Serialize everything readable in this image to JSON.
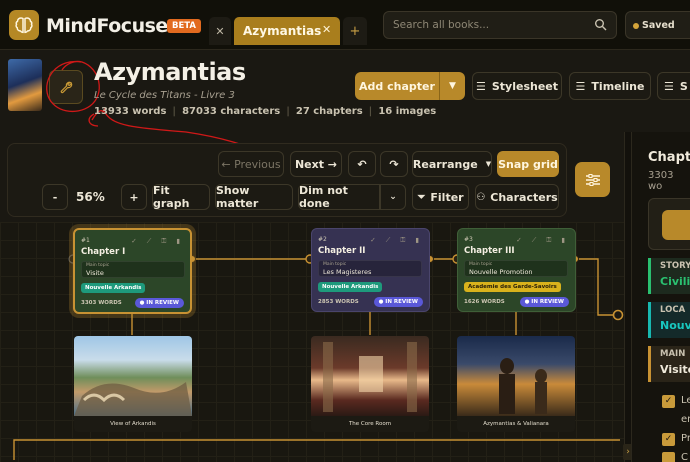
{
  "app": {
    "name": "MindFocuser",
    "badge": "BETA"
  },
  "tabs": [
    {
      "label": "Azymantias",
      "active": true
    }
  ],
  "search": {
    "placeholder": "Search all books..."
  },
  "status": {
    "saved": "Saved"
  },
  "book": {
    "title": "Azymantias",
    "subtitle": "Le Cycle des Titans - Livre 3",
    "words": "13933 words",
    "characters": "87033 characters",
    "chapters": "27 chapters",
    "images": "16 images"
  },
  "header_buttons": {
    "add_chapter": "Add chapter",
    "stylesheet": "Stylesheet",
    "timeline": "Timeline",
    "clipped": "S"
  },
  "toolbar": {
    "previous": "← Previous",
    "next": "Next →",
    "rearrange": "Rearrange",
    "snap_grid": "Snap grid",
    "zoom_minus": "-",
    "zoom": "56%",
    "zoom_plus": "+",
    "fit_graph": "Fit graph",
    "show_matter": "Show matter",
    "dim_not_done": "Dim not done",
    "filter": "Filter",
    "characters": "Characters"
  },
  "chapters": [
    {
      "num": "#1",
      "title": "Chapter I",
      "topic_label": "Main topic",
      "topic": "Visite",
      "tag": "Nouvelle Arkandis",
      "tag_color": "#1e9a7c",
      "words": "3303 WORDS",
      "status": "● IN REVIEW",
      "card_color": "#2b4a2a",
      "image_caption": "View of Arkandis"
    },
    {
      "num": "#2",
      "title": "Chapter II",
      "topic_label": "Main topic",
      "topic": "Les Magisteres",
      "tag": "Nouvelle Arkandis",
      "tag_color": "#1e9a7c",
      "words": "2853 WORDS",
      "status": "● IN REVIEW",
      "card_color": "#3a3558",
      "image_caption": "The Core Room"
    },
    {
      "num": "#3",
      "title": "Chapter III",
      "topic_label": "Main topic",
      "topic": "Nouvelle Promotion",
      "tag": "Academie des Garde-Savoirs",
      "tag_color": "#d9b21c",
      "words": "1626 WORDS",
      "status": "● IN REVIEW",
      "card_color": "#2b4a2a",
      "image_caption": "Azymantias & Valianara"
    }
  ],
  "right_panel": {
    "title": "Chapte",
    "words": "3303 wo",
    "story_label": "STORY",
    "story_value": "Civilis",
    "location_label": "LOCA",
    "location_value": "Nouv",
    "main_label": "MAIN",
    "main_value": "Visite",
    "check1a": "Le",
    "check1b": "en",
    "check2": "Pr",
    "check3": "C"
  },
  "colors": {
    "accent": "#b8892a",
    "review": "#5a58d8",
    "bg": "#1a1812"
  }
}
